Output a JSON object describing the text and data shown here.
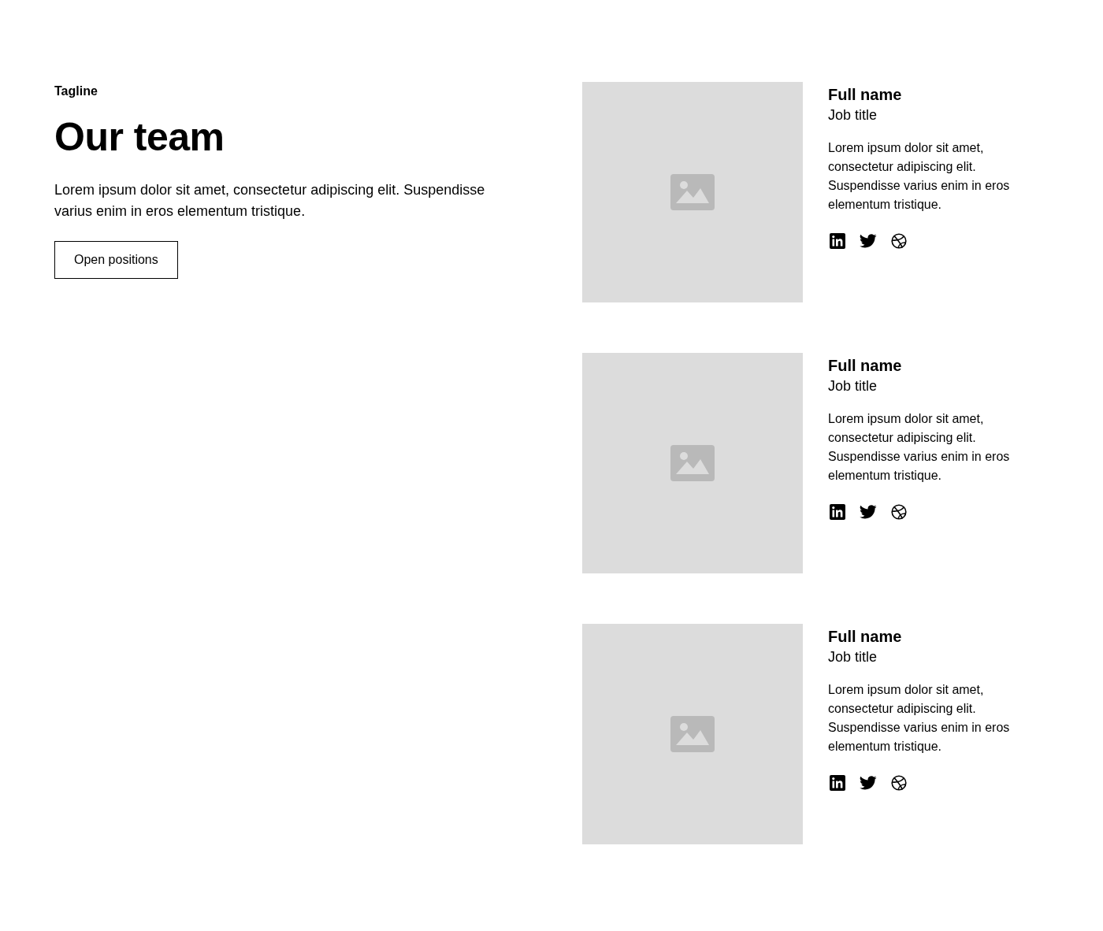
{
  "header": {
    "tagline": "Tagline",
    "heading": "Our team",
    "description": "Lorem ipsum dolor sit amet, consectetur adipiscing elit. Suspendisse varius enim in eros elementum tristique.",
    "button": "Open positions"
  },
  "members": [
    {
      "name": "Full name",
      "job_title": "Job title",
      "bio": "Lorem ipsum dolor sit amet, consectetur adipiscing elit. Suspendisse varius enim in eros elementum tristique.",
      "socials": [
        {
          "kind": "linkedin"
        },
        {
          "kind": "twitter"
        },
        {
          "kind": "dribbble"
        }
      ]
    },
    {
      "name": "Full name",
      "job_title": "Job title",
      "bio": "Lorem ipsum dolor sit amet, consectetur adipiscing elit. Suspendisse varius enim in eros elementum tristique.",
      "socials": [
        {
          "kind": "linkedin"
        },
        {
          "kind": "twitter"
        },
        {
          "kind": "dribbble"
        }
      ]
    },
    {
      "name": "Full name",
      "job_title": "Job title",
      "bio": "Lorem ipsum dolor sit amet, consectetur adipiscing elit. Suspendisse varius enim in eros elementum tristique.",
      "socials": [
        {
          "kind": "linkedin"
        },
        {
          "kind": "twitter"
        },
        {
          "kind": "dribbble"
        }
      ]
    }
  ]
}
